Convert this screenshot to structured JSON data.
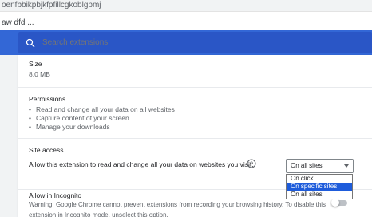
{
  "top": {
    "extension_id": "oenfbbikpbjkfpfillcgkoblgpmj",
    "address_text": "aw dfd ..."
  },
  "search": {
    "placeholder": "Search extensions"
  },
  "details": {
    "size_label": "Size",
    "size_value": "8.0 MB",
    "permissions_label": "Permissions",
    "permissions": [
      "Read and change all your data on all websites",
      "Capture content of your screen",
      "Manage your downloads"
    ],
    "site_access_label": "Site access",
    "site_access_prompt": "Allow this extension to read and change all your data on websites you visit:",
    "site_access_selected": "On all sites",
    "site_access_options": [
      "On click",
      "On specific sites",
      "On all sites"
    ],
    "incognito_label": "Allow in Incognito",
    "incognito_desc": "Warning: Google Chrome cannot prevent extensions from recording your browsing history. To disable this extension in Incognito mode, unselect this option."
  },
  "colors": {
    "header_bg": "#3367d6",
    "search_bg": "#2a56c6",
    "selected_option_bg": "#1e5cdb",
    "page_bg": "#f1f3f4"
  },
  "icons": {
    "search": "search-icon",
    "help": "help-circle-icon",
    "dropdown": "chevron-down-icon"
  }
}
